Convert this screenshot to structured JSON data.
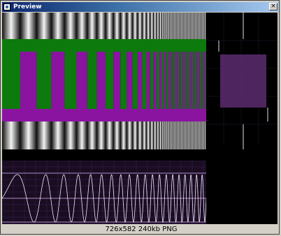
{
  "window": {
    "title": "Preview",
    "close_glyph": "×"
  },
  "caption": {
    "text": "726x582 240kb PNG"
  },
  "colors": {
    "titlebar_start": "#0a246a",
    "green": "#0c7a0c",
    "magenta": "#8a14a0",
    "scope_bg": "#1a0d22",
    "scope_trace": "#f0e8ff",
    "vector_box": "#5c2b6e"
  },
  "icons": {
    "window_icon": "app-icon",
    "close": "close-icon"
  }
}
